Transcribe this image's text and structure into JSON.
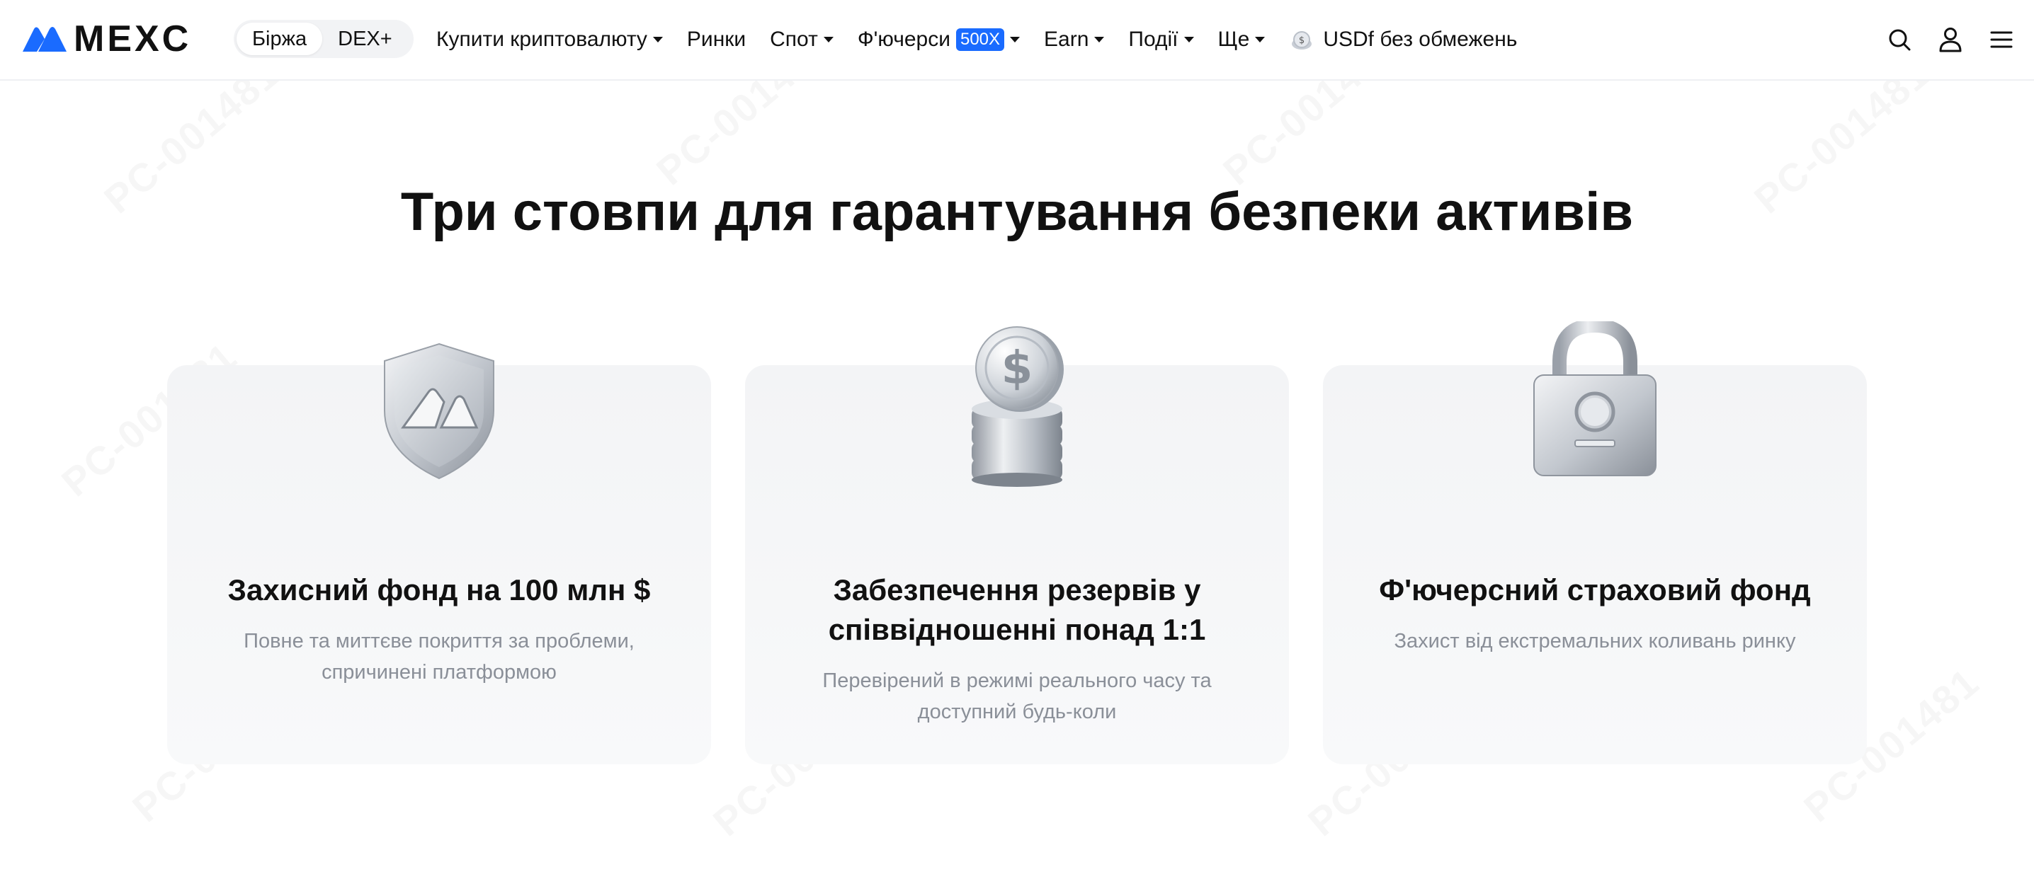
{
  "header": {
    "logo": "MEXC",
    "switch": [
      {
        "label": "Біржа",
        "active": true
      },
      {
        "label": "DEX+",
        "active": false
      }
    ],
    "nav": [
      {
        "label": "Купити криптовалюту",
        "dropdown": true
      },
      {
        "label": "Ринки",
        "dropdown": false
      },
      {
        "label": "Спот",
        "dropdown": true
      },
      {
        "label": "Ф'ючерси",
        "badge": "500X",
        "dropdown": true
      },
      {
        "label": "Earn",
        "dropdown": true
      },
      {
        "label": "Події",
        "dropdown": true
      },
      {
        "label": "Ще",
        "dropdown": true
      },
      {
        "label": "USDf без обмежень",
        "dropdown": false,
        "icon": "coin-icon"
      }
    ],
    "right_icons": [
      "search-icon",
      "user-icon",
      "menu-icon"
    ]
  },
  "main": {
    "title": "Три стовпи для гарантування безпеки активів",
    "cards": [
      {
        "icon": "shield-icon",
        "title": "Захисний фонд на 100 млн $",
        "description": "Повне та миттєве покриття за проблеми, спричинені платформою"
      },
      {
        "icon": "coins-icon",
        "title": "Забезпечення резервів у співвідношенні понад 1:1",
        "description": "Перевірений в режимі реального часу та доступний будь-коли"
      },
      {
        "icon": "lock-icon",
        "title": "Ф'ючерсний страховий фонд",
        "description": "Захист від екстремальних коливань ринку"
      }
    ]
  },
  "watermark": "PC-001481",
  "colors": {
    "accent": "#1a6bff",
    "text": "#111111",
    "muted": "#8a8f98",
    "card_bg": "#f5f6f8"
  }
}
